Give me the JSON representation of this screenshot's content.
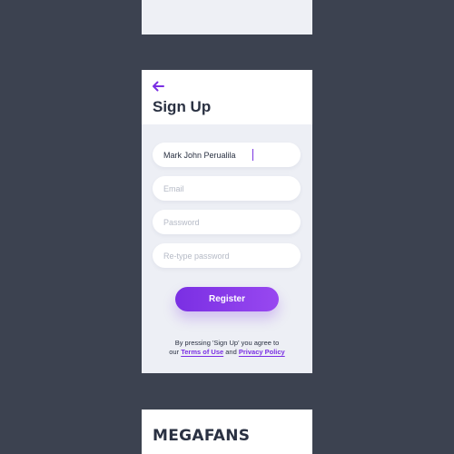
{
  "screen": {
    "title": "Sign Up",
    "accent_color": "#7a2fe3",
    "back_icon": "arrow-left-icon"
  },
  "form": {
    "name_value": "Mark John Perualila",
    "email_placeholder": "Email",
    "password_placeholder": "Password",
    "retype_placeholder": "Re-type password",
    "register_label": "Register"
  },
  "terms": {
    "line1": "By pressing 'Sign Up' you agree to",
    "prefix": "our ",
    "terms_link": "Terms of Use",
    "and": " and ",
    "privacy_link": "Privacy Policy"
  },
  "next_screen": {
    "brand": "MEGAFANS"
  }
}
